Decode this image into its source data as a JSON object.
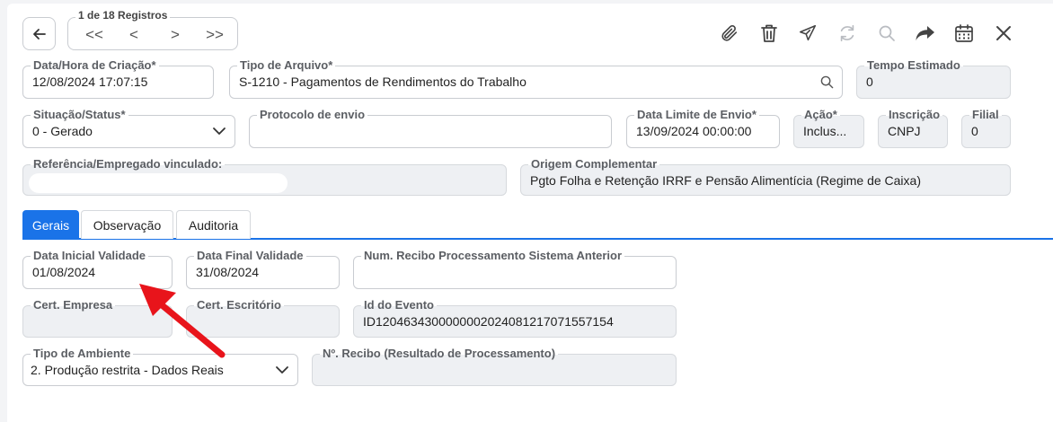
{
  "navigation": {
    "record_counter": "1 de 18 Registros",
    "first": "<<",
    "prev": "<",
    "next": ">",
    "last": ">>"
  },
  "toolbar": {
    "icons": [
      "paperclip-icon",
      "trash-icon",
      "send-icon",
      "refresh-icon",
      "search-icon",
      "forward-icon",
      "calendar-icon",
      "close-icon"
    ]
  },
  "form": {
    "data_hora_criacao": {
      "label": "Data/Hora de Criação*",
      "value": "12/08/2024 17:07:15"
    },
    "tipo_arquivo": {
      "label": "Tipo de Arquivo*",
      "value": "S-1210 - Pagamentos de Rendimentos do Trabalho"
    },
    "tempo_estimado": {
      "label": "Tempo Estimado",
      "value": "0"
    },
    "situacao_status": {
      "label": "Situação/Status*",
      "value": "0 - Gerado"
    },
    "protocolo_envio": {
      "label": "Protocolo de envio",
      "value": ""
    },
    "data_limite_envio": {
      "label": "Data Limite de Envio*",
      "value": "13/09/2024 00:00:00"
    },
    "acao": {
      "label": "Ação*",
      "value": "Inclus..."
    },
    "inscricao": {
      "label": "Inscrição",
      "value": "CNPJ"
    },
    "filial": {
      "label": "Filial",
      "value": "0"
    },
    "referencia_empregado": {
      "label": "Referência/Empregado vinculado:",
      "value": ""
    },
    "origem_complementar": {
      "label": "Origem Complementar",
      "value": "Pgto Folha e Retenção IRRF e Pensão Alimentícia (Regime de Caixa)"
    }
  },
  "tabs": [
    {
      "label": "Gerais",
      "active": true
    },
    {
      "label": "Observação",
      "active": false
    },
    {
      "label": "Auditoria",
      "active": false
    }
  ],
  "gerais": {
    "data_inicial_validade": {
      "label": "Data Inicial Validade",
      "value": "01/08/2024"
    },
    "data_final_validade": {
      "label": "Data Final Validade",
      "value": "31/08/2024"
    },
    "num_recibo_anterior": {
      "label": "Num. Recibo Processamento Sistema Anterior",
      "value": ""
    },
    "cert_empresa": {
      "label": "Cert. Empresa",
      "value": ""
    },
    "cert_escritorio": {
      "label": "Cert. Escritório",
      "value": ""
    },
    "id_evento": {
      "label": "Id do Evento",
      "value": "ID1204634300000002024081217071557154"
    },
    "tipo_ambiente": {
      "label": "Tipo de Ambiente",
      "value": "2. Produção restrita - Dados Reais"
    },
    "num_recibo_resultado": {
      "label": "Nº. Recibo (Resultado de Processamento)",
      "value": ""
    }
  },
  "colors": {
    "accent": "#1a73e8",
    "annotation_arrow": "#e8141b"
  }
}
